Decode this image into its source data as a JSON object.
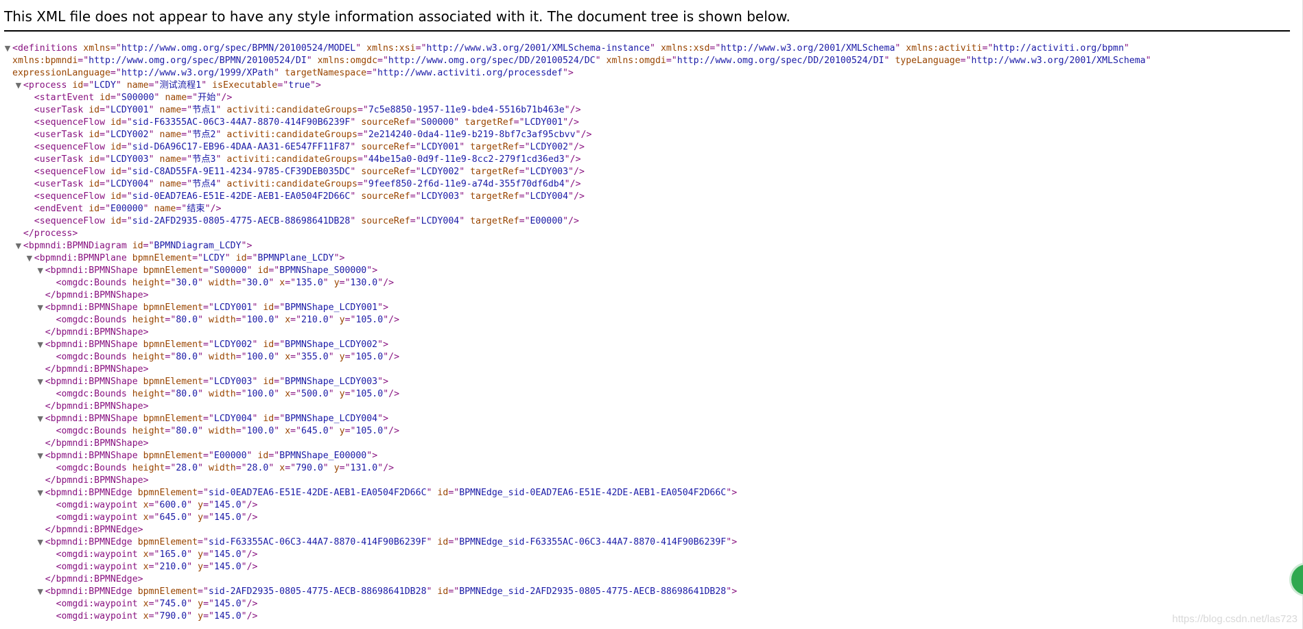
{
  "header": {
    "message": "This XML file does not appear to have any style information associated with it. The document tree is shown below."
  },
  "watermark": "https://blog.csdn.net/las723",
  "icons": {
    "expand": "expand-triangle-icon"
  },
  "colors": {
    "tag": "#881280",
    "attr_name": "#994500",
    "attr_value": "#1a1aa6"
  },
  "lines": [
    {
      "i": 0,
      "t": 1,
      "k": "o",
      "n": "definitions",
      "a": [
        [
          "xmlns",
          "http://www.omg.org/spec/BPMN/20100524/MODEL"
        ],
        [
          "xmlns:xsi",
          "http://www.w3.org/2001/XMLSchema-instance"
        ],
        [
          "xmlns:xsd",
          "http://www.w3.org/2001/XMLSchema"
        ],
        [
          "xmlns:activiti",
          "http://activiti.org/bpmn"
        ]
      ],
      "e": ""
    },
    {
      "i": 0,
      "k": "c",
      "a": [
        [
          "xmlns:bpmndi",
          "http://www.omg.org/spec/BPMN/20100524/DI"
        ],
        [
          "xmlns:omgdc",
          "http://www.omg.org/spec/DD/20100524/DC"
        ],
        [
          "xmlns:omgdi",
          "http://www.omg.org/spec/DD/20100524/DI"
        ],
        [
          "typeLanguage",
          "http://www.w3.org/2001/XMLSchema"
        ]
      ],
      "e": ""
    },
    {
      "i": 0,
      "k": "c",
      "a": [
        [
          "expressionLanguage",
          "http://www.w3.org/1999/XPath"
        ],
        [
          "targetNamespace",
          "http://www.activiti.org/processdef"
        ]
      ],
      "e": ">"
    },
    {
      "i": 1,
      "t": 1,
      "k": "o",
      "n": "process",
      "a": [
        [
          "id",
          "LCDY"
        ],
        [
          "name",
          "测试流程1"
        ],
        [
          "isExecutable",
          "true"
        ]
      ],
      "e": ">"
    },
    {
      "i": 2,
      "k": "o",
      "n": "startEvent",
      "a": [
        [
          "id",
          "S00000"
        ],
        [
          "name",
          "开始"
        ]
      ],
      "e": "/>"
    },
    {
      "i": 2,
      "k": "o",
      "n": "userTask",
      "a": [
        [
          "id",
          "LCDY001"
        ],
        [
          "name",
          "节点1"
        ],
        [
          "activiti:candidateGroups",
          "7c5e8850-1957-11e9-bde4-5516b71b463e"
        ]
      ],
      "e": "/>"
    },
    {
      "i": 2,
      "k": "o",
      "n": "sequenceFlow",
      "a": [
        [
          "id",
          "sid-F63355AC-06C3-44A7-8870-414F90B6239F"
        ],
        [
          "sourceRef",
          "S00000"
        ],
        [
          "targetRef",
          "LCDY001"
        ]
      ],
      "e": "/>"
    },
    {
      "i": 2,
      "k": "o",
      "n": "userTask",
      "a": [
        [
          "id",
          "LCDY002"
        ],
        [
          "name",
          "节点2"
        ],
        [
          "activiti:candidateGroups",
          "2e214240-0da4-11e9-b219-8bf7c3af95cbvv"
        ]
      ],
      "e": "/>"
    },
    {
      "i": 2,
      "k": "o",
      "n": "sequenceFlow",
      "a": [
        [
          "id",
          "sid-D6A96C17-EB96-4DAA-AA31-6E547FF11F87"
        ],
        [
          "sourceRef",
          "LCDY001"
        ],
        [
          "targetRef",
          "LCDY002"
        ]
      ],
      "e": "/>"
    },
    {
      "i": 2,
      "k": "o",
      "n": "userTask",
      "a": [
        [
          "id",
          "LCDY003"
        ],
        [
          "name",
          "节点3"
        ],
        [
          "activiti:candidateGroups",
          "44be15a0-0d9f-11e9-8cc2-279f1cd36ed3"
        ]
      ],
      "e": "/>"
    },
    {
      "i": 2,
      "k": "o",
      "n": "sequenceFlow",
      "a": [
        [
          "id",
          "sid-C8AD55FA-9E11-4234-9785-CF39DEB035DC"
        ],
        [
          "sourceRef",
          "LCDY002"
        ],
        [
          "targetRef",
          "LCDY003"
        ]
      ],
      "e": "/>"
    },
    {
      "i": 2,
      "k": "o",
      "n": "userTask",
      "a": [
        [
          "id",
          "LCDY004"
        ],
        [
          "name",
          "节点4"
        ],
        [
          "activiti:candidateGroups",
          "9feef850-2f6d-11e9-a74d-355f70df6db4"
        ]
      ],
      "e": "/>"
    },
    {
      "i": 2,
      "k": "o",
      "n": "sequenceFlow",
      "a": [
        [
          "id",
          "sid-0EAD7EA6-E51E-42DE-AEB1-EA0504F2D66C"
        ],
        [
          "sourceRef",
          "LCDY003"
        ],
        [
          "targetRef",
          "LCDY004"
        ]
      ],
      "e": "/>"
    },
    {
      "i": 2,
      "k": "o",
      "n": "endEvent",
      "a": [
        [
          "id",
          "E00000"
        ],
        [
          "name",
          "结束"
        ]
      ],
      "e": "/>"
    },
    {
      "i": 2,
      "k": "o",
      "n": "sequenceFlow",
      "a": [
        [
          "id",
          "sid-2AFD2935-0805-4775-AECB-88698641DB28"
        ],
        [
          "sourceRef",
          "LCDY004"
        ],
        [
          "targetRef",
          "E00000"
        ]
      ],
      "e": "/>"
    },
    {
      "i": 1,
      "k": "x",
      "n": "process"
    },
    {
      "i": 1,
      "t": 1,
      "k": "o",
      "n": "bpmndi:BPMNDiagram",
      "a": [
        [
          "id",
          "BPMNDiagram_LCDY"
        ]
      ],
      "e": ">"
    },
    {
      "i": 2,
      "t": 1,
      "k": "o",
      "n": "bpmndi:BPMNPlane",
      "a": [
        [
          "bpmnElement",
          "LCDY"
        ],
        [
          "id",
          "BPMNPlane_LCDY"
        ]
      ],
      "e": ">"
    },
    {
      "i": 3,
      "t": 1,
      "k": "o",
      "n": "bpmndi:BPMNShape",
      "a": [
        [
          "bpmnElement",
          "S00000"
        ],
        [
          "id",
          "BPMNShape_S00000"
        ]
      ],
      "e": ">"
    },
    {
      "i": 4,
      "k": "o",
      "n": "omgdc:Bounds",
      "a": [
        [
          "height",
          "30.0"
        ],
        [
          "width",
          "30.0"
        ],
        [
          "x",
          "135.0"
        ],
        [
          "y",
          "130.0"
        ]
      ],
      "e": "/>"
    },
    {
      "i": 3,
      "k": "x",
      "n": "bpmndi:BPMNShape"
    },
    {
      "i": 3,
      "t": 1,
      "k": "o",
      "n": "bpmndi:BPMNShape",
      "a": [
        [
          "bpmnElement",
          "LCDY001"
        ],
        [
          "id",
          "BPMNShape_LCDY001"
        ]
      ],
      "e": ">"
    },
    {
      "i": 4,
      "k": "o",
      "n": "omgdc:Bounds",
      "a": [
        [
          "height",
          "80.0"
        ],
        [
          "width",
          "100.0"
        ],
        [
          "x",
          "210.0"
        ],
        [
          "y",
          "105.0"
        ]
      ],
      "e": "/>"
    },
    {
      "i": 3,
      "k": "x",
      "n": "bpmndi:BPMNShape"
    },
    {
      "i": 3,
      "t": 1,
      "k": "o",
      "n": "bpmndi:BPMNShape",
      "a": [
        [
          "bpmnElement",
          "LCDY002"
        ],
        [
          "id",
          "BPMNShape_LCDY002"
        ]
      ],
      "e": ">"
    },
    {
      "i": 4,
      "k": "o",
      "n": "omgdc:Bounds",
      "a": [
        [
          "height",
          "80.0"
        ],
        [
          "width",
          "100.0"
        ],
        [
          "x",
          "355.0"
        ],
        [
          "y",
          "105.0"
        ]
      ],
      "e": "/>"
    },
    {
      "i": 3,
      "k": "x",
      "n": "bpmndi:BPMNShape"
    },
    {
      "i": 3,
      "t": 1,
      "k": "o",
      "n": "bpmndi:BPMNShape",
      "a": [
        [
          "bpmnElement",
          "LCDY003"
        ],
        [
          "id",
          "BPMNShape_LCDY003"
        ]
      ],
      "e": ">"
    },
    {
      "i": 4,
      "k": "o",
      "n": "omgdc:Bounds",
      "a": [
        [
          "height",
          "80.0"
        ],
        [
          "width",
          "100.0"
        ],
        [
          "x",
          "500.0"
        ],
        [
          "y",
          "105.0"
        ]
      ],
      "e": "/>"
    },
    {
      "i": 3,
      "k": "x",
      "n": "bpmndi:BPMNShape"
    },
    {
      "i": 3,
      "t": 1,
      "k": "o",
      "n": "bpmndi:BPMNShape",
      "a": [
        [
          "bpmnElement",
          "LCDY004"
        ],
        [
          "id",
          "BPMNShape_LCDY004"
        ]
      ],
      "e": ">"
    },
    {
      "i": 4,
      "k": "o",
      "n": "omgdc:Bounds",
      "a": [
        [
          "height",
          "80.0"
        ],
        [
          "width",
          "100.0"
        ],
        [
          "x",
          "645.0"
        ],
        [
          "y",
          "105.0"
        ]
      ],
      "e": "/>"
    },
    {
      "i": 3,
      "k": "x",
      "n": "bpmndi:BPMNShape"
    },
    {
      "i": 3,
      "t": 1,
      "k": "o",
      "n": "bpmndi:BPMNShape",
      "a": [
        [
          "bpmnElement",
          "E00000"
        ],
        [
          "id",
          "BPMNShape_E00000"
        ]
      ],
      "e": ">"
    },
    {
      "i": 4,
      "k": "o",
      "n": "omgdc:Bounds",
      "a": [
        [
          "height",
          "28.0"
        ],
        [
          "width",
          "28.0"
        ],
        [
          "x",
          "790.0"
        ],
        [
          "y",
          "131.0"
        ]
      ],
      "e": "/>"
    },
    {
      "i": 3,
      "k": "x",
      "n": "bpmndi:BPMNShape"
    },
    {
      "i": 3,
      "t": 1,
      "k": "o",
      "n": "bpmndi:BPMNEdge",
      "a": [
        [
          "bpmnElement",
          "sid-0EAD7EA6-E51E-42DE-AEB1-EA0504F2D66C"
        ],
        [
          "id",
          "BPMNEdge_sid-0EAD7EA6-E51E-42DE-AEB1-EA0504F2D66C"
        ]
      ],
      "e": ">"
    },
    {
      "i": 4,
      "k": "o",
      "n": "omgdi:waypoint",
      "a": [
        [
          "x",
          "600.0"
        ],
        [
          "y",
          "145.0"
        ]
      ],
      "e": "/>"
    },
    {
      "i": 4,
      "k": "o",
      "n": "omgdi:waypoint",
      "a": [
        [
          "x",
          "645.0"
        ],
        [
          "y",
          "145.0"
        ]
      ],
      "e": "/>"
    },
    {
      "i": 3,
      "k": "x",
      "n": "bpmndi:BPMNEdge"
    },
    {
      "i": 3,
      "t": 1,
      "k": "o",
      "n": "bpmndi:BPMNEdge",
      "a": [
        [
          "bpmnElement",
          "sid-F63355AC-06C3-44A7-8870-414F90B6239F"
        ],
        [
          "id",
          "BPMNEdge_sid-F63355AC-06C3-44A7-8870-414F90B6239F"
        ]
      ],
      "e": ">"
    },
    {
      "i": 4,
      "k": "o",
      "n": "omgdi:waypoint",
      "a": [
        [
          "x",
          "165.0"
        ],
        [
          "y",
          "145.0"
        ]
      ],
      "e": "/>"
    },
    {
      "i": 4,
      "k": "o",
      "n": "omgdi:waypoint",
      "a": [
        [
          "x",
          "210.0"
        ],
        [
          "y",
          "145.0"
        ]
      ],
      "e": "/>"
    },
    {
      "i": 3,
      "k": "x",
      "n": "bpmndi:BPMNEdge"
    },
    {
      "i": 3,
      "t": 1,
      "k": "o",
      "n": "bpmndi:BPMNEdge",
      "a": [
        [
          "bpmnElement",
          "sid-2AFD2935-0805-4775-AECB-88698641DB28"
        ],
        [
          "id",
          "BPMNEdge_sid-2AFD2935-0805-4775-AECB-88698641DB28"
        ]
      ],
      "e": ">"
    },
    {
      "i": 4,
      "k": "o",
      "n": "omgdi:waypoint",
      "a": [
        [
          "x",
          "745.0"
        ],
        [
          "y",
          "145.0"
        ]
      ],
      "e": "/>"
    },
    {
      "i": 4,
      "k": "o",
      "n": "omgdi:waypoint",
      "a": [
        [
          "x",
          "790.0"
        ],
        [
          "y",
          "145.0"
        ]
      ],
      "e": "/>"
    }
  ]
}
